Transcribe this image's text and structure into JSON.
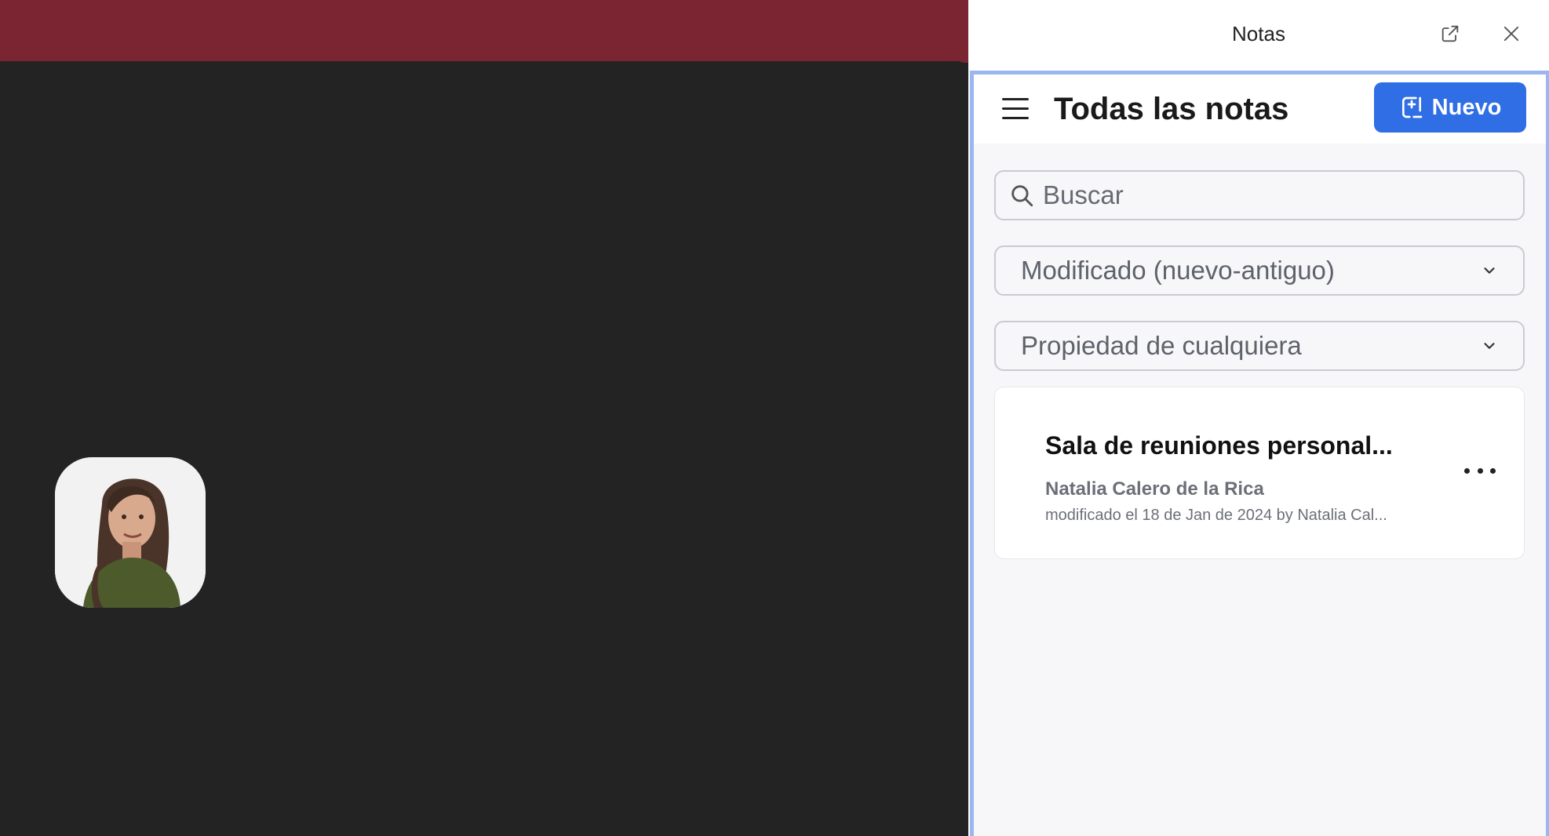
{
  "meeting": {
    "participant": {
      "name": "Natalia Calero de la Rica",
      "avatar_icon": "participant-photo"
    },
    "colors": {
      "topbar": "#7b2432",
      "stage": "#232323"
    }
  },
  "panel": {
    "title": "Notas",
    "icons": {
      "popout": "external-link-icon",
      "close": "close-icon"
    },
    "heading": "Todas las notas",
    "new_button_label": "Nuevo",
    "search": {
      "placeholder": "Buscar",
      "value": ""
    },
    "sort_select": {
      "selected": "Modificado (nuevo-antiguo)"
    },
    "owner_select": {
      "selected": "Propiedad de cualquiera"
    },
    "notes": [
      {
        "title": "Sala de reuniones personal...",
        "owner": "Natalia Calero de la Rica",
        "meta": "modificado el 18 de Jan de 2024 by Natalia Cal..."
      }
    ],
    "colors": {
      "accent": "#2f6ee5",
      "frame_border": "#9cb6f0"
    }
  }
}
